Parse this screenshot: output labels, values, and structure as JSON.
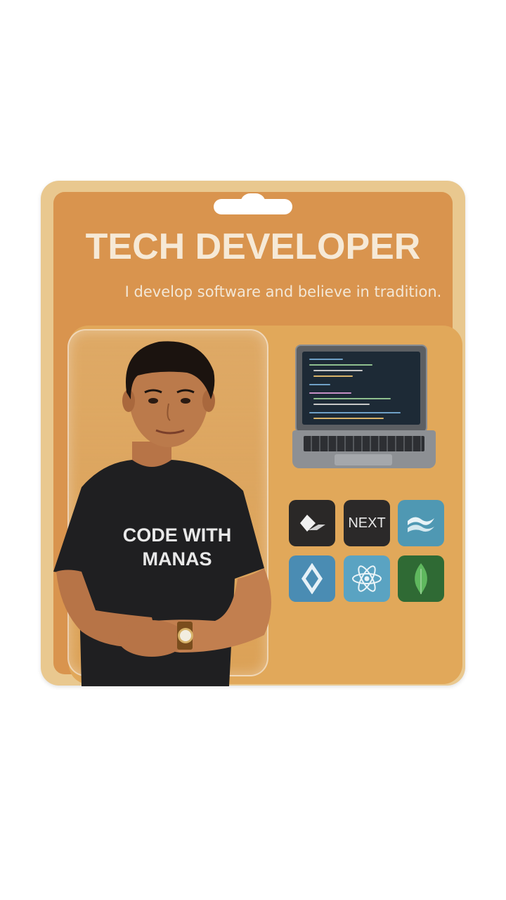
{
  "package": {
    "title": "TECH DEVELOPER",
    "subtitle": "I develop software and believe in tradition."
  },
  "figure": {
    "shirt_text_line1": "CODE WITH",
    "shirt_text_line2": "MANAS"
  },
  "tech_icons": [
    {
      "name": "flutter-dart-icon",
      "label": ""
    },
    {
      "name": "nextjs-icon",
      "label": "NEXT"
    },
    {
      "name": "tailwind-icon",
      "label": ""
    },
    {
      "name": "flutter-icon",
      "label": ""
    },
    {
      "name": "react-icon",
      "label": ""
    },
    {
      "name": "mongodb-icon",
      "label": ""
    }
  ],
  "colors": {
    "card_outer": "#e9c88f",
    "card_inner": "#d9944e",
    "title_text": "#f6e9d6",
    "shirt": "#1f1f21"
  }
}
